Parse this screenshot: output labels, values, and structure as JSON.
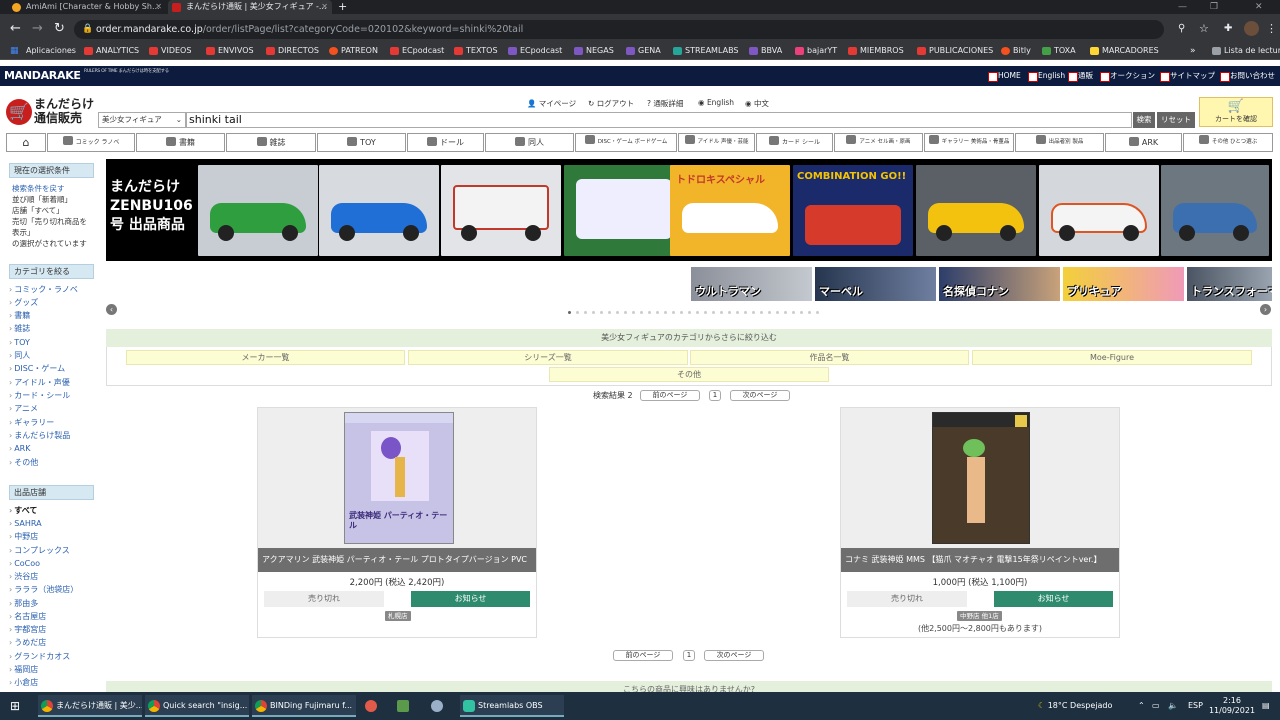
{
  "browser": {
    "tabs": [
      {
        "title": "AmiAmi [Character & Hobby Sh...",
        "active": false
      },
      {
        "title": "まんだらけ通販 | 美少女フィギュア -...",
        "active": true
      }
    ],
    "new_tab": "+",
    "url_host": "order.mandarake.co.jp",
    "url_path": "/order/listPage/list?categoryCode=020102&keyword=shinki%20tail",
    "bookmarks": [
      {
        "label": "Aplicaciones",
        "color": "#4285f4"
      },
      {
        "label": "ANALYTICS",
        "color": "#e53935"
      },
      {
        "label": "VIDEOS",
        "color": "#e53935"
      },
      {
        "label": "ENVIVOS",
        "color": "#e53935"
      },
      {
        "label": "DIRECTOS",
        "color": "#e53935"
      },
      {
        "label": "PATREON",
        "color": "#f4511e"
      },
      {
        "label": "ECpodcast",
        "color": "#e53935"
      },
      {
        "label": "TEXTOS",
        "color": "#e53935"
      },
      {
        "label": "ECpodcast",
        "color": "#7e57c2"
      },
      {
        "label": "NEGAS",
        "color": "#7e57c2"
      },
      {
        "label": "GENA",
        "color": "#7e57c2"
      },
      {
        "label": "STREAMLABS",
        "color": "#26a69a"
      },
      {
        "label": "BBVA",
        "color": "#7e57c2"
      },
      {
        "label": "bajarYT",
        "color": "#ec407a"
      },
      {
        "label": "MIEMBROS",
        "color": "#e53935"
      },
      {
        "label": "PUBLICACIONES",
        "color": "#e53935"
      },
      {
        "label": "Bitly",
        "color": "#f4511e"
      },
      {
        "label": "TOXA",
        "color": "#43a047"
      },
      {
        "label": "MARCADORES",
        "color": "#fdd835"
      }
    ],
    "reading_list": "Lista de lectura"
  },
  "site": {
    "logo": "MANDARAKE",
    "logo_tagline": "RULERS OF TIME まんだらけは時を支配する",
    "top_links": [
      "HOME",
      "English",
      "通販",
      "オークション",
      "サイトマップ",
      "お問い合わせ"
    ],
    "brand": "まんだらけ通信販売",
    "util_links": [
      "マイページ",
      "ログアウト",
      "通販詳細",
      "English",
      "中文"
    ],
    "search": {
      "category": "美少女フィギュア",
      "keyword": "shinki tail",
      "search_button": "検索",
      "reset_button": "リセット"
    },
    "cart_button": "カートを確認",
    "nav": [
      "",
      "コミック ラノベ",
      "書籍",
      "雑誌",
      "TOY",
      "ドール",
      "同人",
      "DISC・ゲーム ボードゲーム",
      "アイドル 声優・芸能",
      "カード シール",
      "アニメ セル画・原画",
      "ギャラリー 美術品・骨董品",
      "出品者別 製品",
      "ARK",
      "その他 ひとつ選ぶ"
    ]
  },
  "sidebar": {
    "current_head": "現在の選択条件",
    "current_text": [
      "検索条件を戻す",
      "並び順「新着順」",
      "店舗「すべて」",
      "売切「売り切れ商品を表示」",
      "の選択がされています"
    ],
    "category_head": "カテゴリを絞る",
    "categories": [
      "コミック・ラノベ",
      "グッズ",
      "書籍",
      "雑誌",
      "TOY",
      "同人",
      "DISC・ゲーム",
      "アイドル・声優",
      "カード・シール",
      "アニメ",
      "ギャラリー",
      "まんだらけ製品",
      "ARK",
      "その他"
    ],
    "store_head": "出品店舗",
    "stores": [
      "すべて",
      "SAHRA",
      "中野店",
      "コンプレックス",
      "CoCoo",
      "渋谷店",
      "ラララ（池袋店）",
      "那由多",
      "名古屋店",
      "宇都宮店",
      "うめだ店",
      "グランドカオス",
      "福岡店",
      "小倉店"
    ]
  },
  "banner": {
    "headline": "まんだらけ ZENBU106号 出品商品",
    "thumb_texts": [
      "",
      "",
      "",
      "",
      "トドロキスペシャル",
      "COMBINATION GO!!",
      "",
      "",
      ""
    ],
    "strips": [
      "ウルトラマン",
      "マーベル",
      "名探偵コナン",
      "プリキュア",
      "トランスフォーマー"
    ],
    "prev": "‹",
    "next": "›"
  },
  "refine": {
    "head": "美少女フィギュアのカテゴリからさらに絞り込む",
    "buttons": [
      "メーカー一覧",
      "シリーズ一覧",
      "作品名一覧",
      "Moe-Figure",
      "その他"
    ]
  },
  "results": {
    "count_label": "検索結果 2",
    "prev_page": "前のページ",
    "page": "1",
    "next_page": "次のページ"
  },
  "products": [
    {
      "title": "アクアマリン 武装神姫 パーティオ・テール プロトタイプバージョン PVC",
      "price": "2,200円 (税込 2,420円)",
      "sold_out": "売り切れ",
      "notify": "お知らせ",
      "store": "札幌店",
      "box_text": "武装神姫 パーティオ・テール",
      "alt": ""
    },
    {
      "title": "コナミ 武装神姫 MMS 【猫爪 マオチャオ 電撃15年祭リペイントver.】",
      "price": "1,000円 (税込 1,100円)",
      "sold_out": "売り切れ",
      "notify": "お知らせ",
      "store": "中野店 他1店",
      "box_text": "",
      "alt": "(他2,500円〜2,800円もあります)"
    }
  ],
  "bottom_banner": "こちらの商品に興味はありませんか?",
  "taskbar": {
    "apps": [
      "まんだらけ通販 | 美少...",
      "Quick search \"insig...",
      "BINDing Fujimaru f...",
      "",
      "",
      "",
      "Streamlabs OBS"
    ],
    "weather": "18°C Despejado",
    "lang": "ESP",
    "time": "2:16",
    "date": "11/09/2021"
  }
}
